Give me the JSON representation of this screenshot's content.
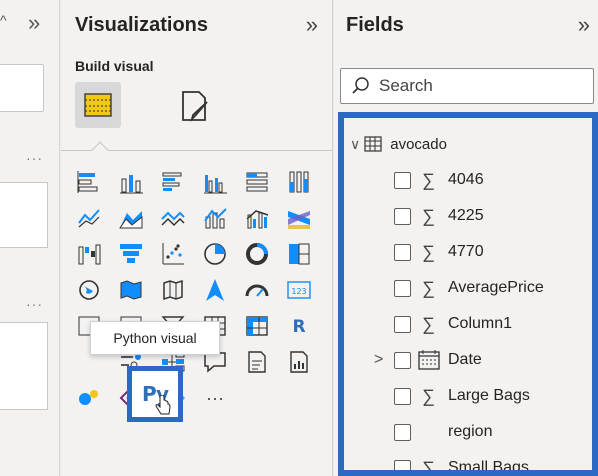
{
  "viz": {
    "title": "Visualizations",
    "build_label": "Build visual",
    "tooltip": "Python visual",
    "python_label": "Py",
    "more": "···",
    "r_label": "R",
    "kpi_label": "123"
  },
  "fields": {
    "title": "Fields",
    "search_placeholder": "Search",
    "table_name": "avocado",
    "items": [
      {
        "label": "4046",
        "icon": "sigma"
      },
      {
        "label": "4225",
        "icon": "sigma"
      },
      {
        "label": "4770",
        "icon": "sigma"
      },
      {
        "label": "AveragePrice",
        "icon": "sigma"
      },
      {
        "label": "Column1",
        "icon": "sigma"
      },
      {
        "label": "Date",
        "icon": "calendar"
      },
      {
        "label": "Large Bags",
        "icon": "sigma"
      },
      {
        "label": "region",
        "icon": "none"
      },
      {
        "label": "Small Bags",
        "icon": "sigma"
      }
    ]
  },
  "colors": {
    "highlight": "#2c69c4",
    "pane_bg": "#f3f2f1",
    "accent_yellow": "#f2c811",
    "python_blue": "#2e6fb6"
  }
}
